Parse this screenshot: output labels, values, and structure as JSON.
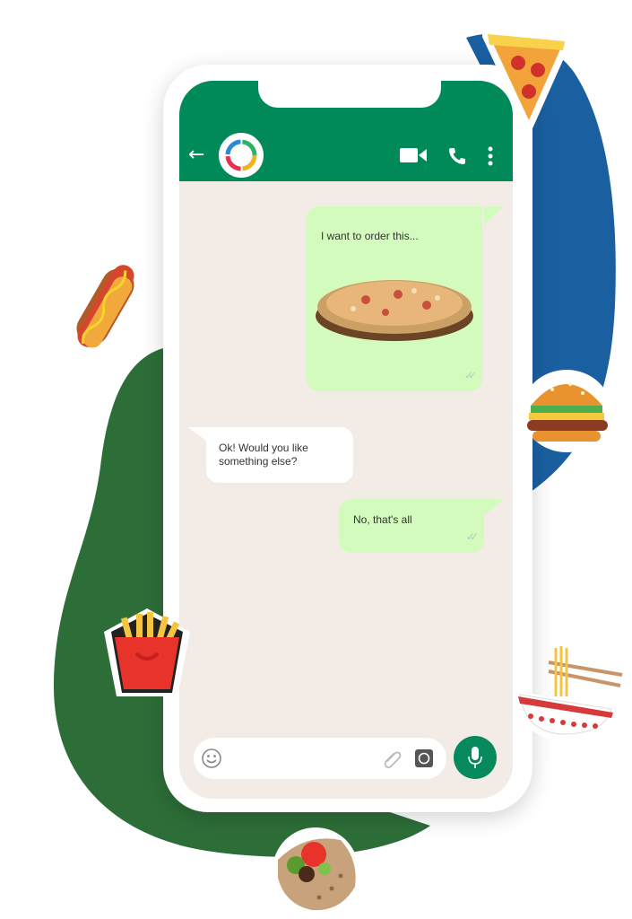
{
  "chat": {
    "messages": [
      {
        "direction": "outgoing",
        "text": "I want to order this..."
      },
      {
        "direction": "incoming",
        "text": "Ok! Would you like something else?"
      },
      {
        "direction": "outgoing",
        "text": "No, that's all"
      }
    ]
  },
  "header": {
    "back_icon": "arrow-left-icon",
    "video_icon": "video-camera-icon",
    "phone_icon": "phone-icon",
    "menu_icon": "more-vertical-icon"
  },
  "input_bar": {
    "placeholder": "",
    "emoji_icon": "emoji-icon",
    "attach_icon": "paperclip-icon",
    "camera_icon": "camera-icon",
    "mic_icon": "microphone-icon"
  },
  "colors": {
    "header": "#008a5a",
    "chat_background": "#f3ece6",
    "outgoing_bubble": "#d3fbbd",
    "incoming_bubble": "#ffffff",
    "blue_blob": "#1a5fa0",
    "green_blob": "#2d6e38"
  },
  "stickers": [
    "pizza-sticker",
    "hotdog-sticker",
    "burger-sticker",
    "fries-sticker",
    "noodles-sticker",
    "taco-sticker"
  ]
}
